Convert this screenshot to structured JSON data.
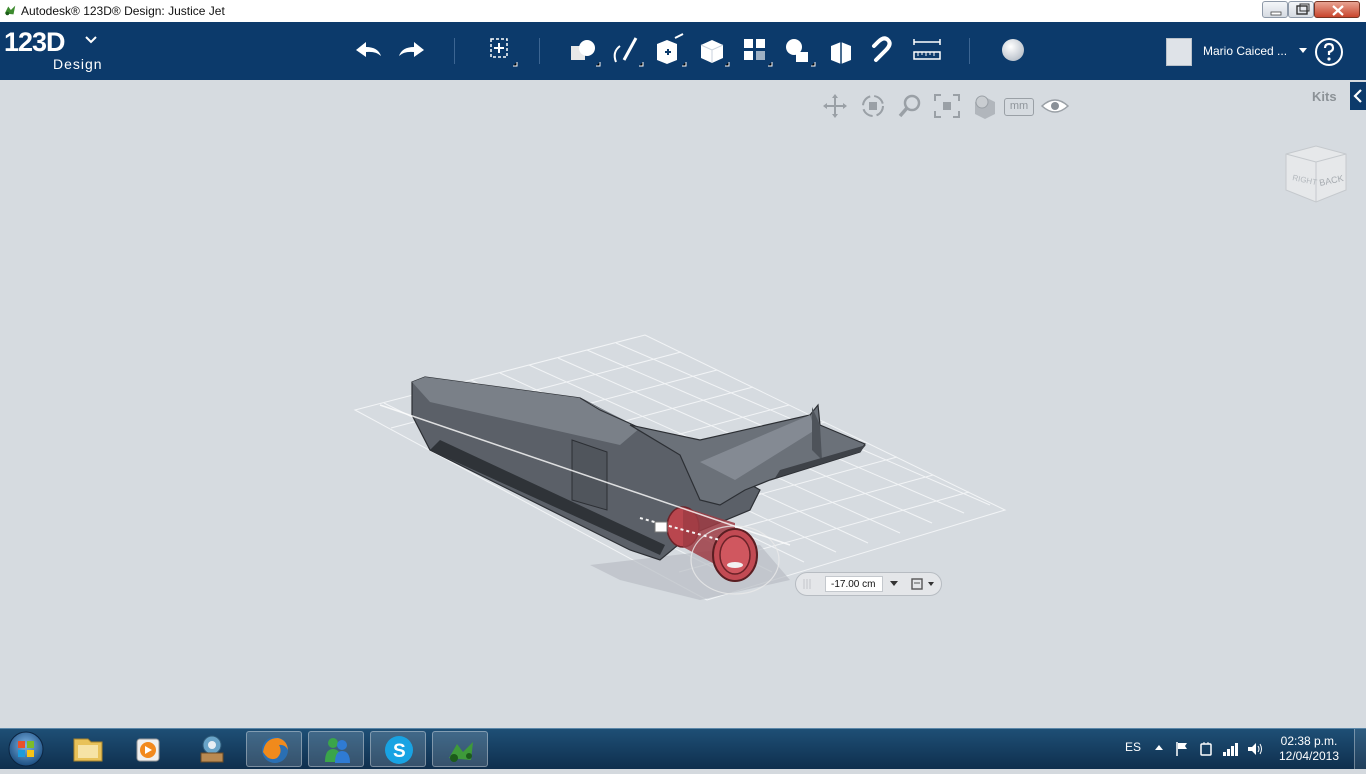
{
  "window": {
    "title": "Autodesk® 123D® Design: Justice Jet"
  },
  "logo": {
    "main": "123D",
    "sub": "Design"
  },
  "toolbar": {
    "tools": [
      {
        "name": "undo-icon"
      },
      {
        "name": "redo-icon"
      },
      {
        "name": "transform-icon"
      },
      {
        "name": "primitives-icon"
      },
      {
        "name": "sketch-icon"
      },
      {
        "name": "construct-icon"
      },
      {
        "name": "modify-icon"
      },
      {
        "name": "pattern-icon"
      },
      {
        "name": "grouping-icon"
      },
      {
        "name": "combine-icon"
      },
      {
        "name": "snap-icon"
      },
      {
        "name": "measure-icon"
      },
      {
        "name": "material-icon"
      }
    ]
  },
  "user": {
    "name": "Mario Caiced ..."
  },
  "viewport": {
    "kits_label": "Kits",
    "nav_tools": [
      "pan-icon",
      "orbit-icon",
      "zoom-icon",
      "fit-icon",
      "view-style-icon",
      "units-icon",
      "visibility-icon"
    ],
    "units_label": "mm",
    "viewcube_faces": [
      "RIGHT",
      "BACK"
    ]
  },
  "dimension_input": {
    "value": "-17.00 cm"
  },
  "taskbar": {
    "apps": [
      "windows-explorer-icon",
      "media-player-icon",
      "dartboard-app-icon",
      "firefox-icon",
      "messenger-icon",
      "skype-icon",
      "123d-design-icon"
    ],
    "language": "ES",
    "time": "02:38 p.m.",
    "date": "12/04/2013"
  }
}
